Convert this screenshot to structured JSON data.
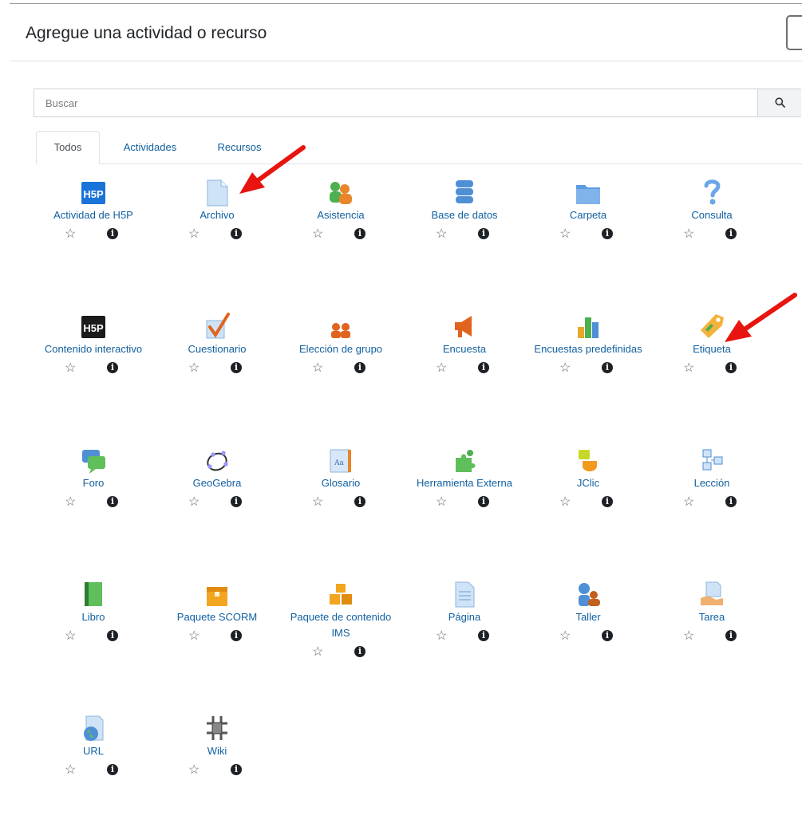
{
  "dialog": {
    "title": "Agregue una actividad o recurso"
  },
  "search": {
    "placeholder": "Buscar"
  },
  "tabs": [
    {
      "label": "Todos"
    },
    {
      "label": "Actividades"
    },
    {
      "label": "Recursos"
    }
  ],
  "items": [
    {
      "name": "Actividad de H5P",
      "icon": "h5p-blue-icon"
    },
    {
      "name": "Archivo",
      "icon": "file-icon"
    },
    {
      "name": "Asistencia",
      "icon": "attendance-icon"
    },
    {
      "name": "Base de datos",
      "icon": "database-icon"
    },
    {
      "name": "Carpeta",
      "icon": "folder-icon"
    },
    {
      "name": "Consulta",
      "icon": "question-icon"
    },
    {
      "name": "Contenido interactivo",
      "icon": "h5p-black-icon"
    },
    {
      "name": "Cuestionario",
      "icon": "quiz-icon"
    },
    {
      "name": "Elección de grupo",
      "icon": "group-choice-icon"
    },
    {
      "name": "Encuesta",
      "icon": "megaphone-icon"
    },
    {
      "name": "Encuestas predefinidas",
      "icon": "survey-chart-icon"
    },
    {
      "name": "Etiqueta",
      "icon": "label-tag-icon"
    },
    {
      "name": "Foro",
      "icon": "forum-icon"
    },
    {
      "name": "GeoGebra",
      "icon": "geogebra-icon"
    },
    {
      "name": "Glosario",
      "icon": "glossary-icon"
    },
    {
      "name": "Herramienta Externa",
      "icon": "puzzle-icon"
    },
    {
      "name": "JClic",
      "icon": "jclic-icon"
    },
    {
      "name": "Lección",
      "icon": "lesson-icon"
    },
    {
      "name": "Libro",
      "icon": "book-icon"
    },
    {
      "name": "Paquete SCORM",
      "icon": "scorm-package-icon"
    },
    {
      "name": "Paquete de contenido IMS",
      "icon": "ims-package-icon"
    },
    {
      "name": "Página",
      "icon": "page-icon"
    },
    {
      "name": "Taller",
      "icon": "workshop-icon"
    },
    {
      "name": "Tarea",
      "icon": "assignment-icon"
    },
    {
      "name": "URL",
      "icon": "url-globe-icon"
    },
    {
      "name": "Wiki",
      "icon": "wiki-icon"
    }
  ],
  "colors": {
    "link": "#1160a0",
    "arrow": "#e8140f",
    "h5p_blue": "#1a73d9"
  }
}
